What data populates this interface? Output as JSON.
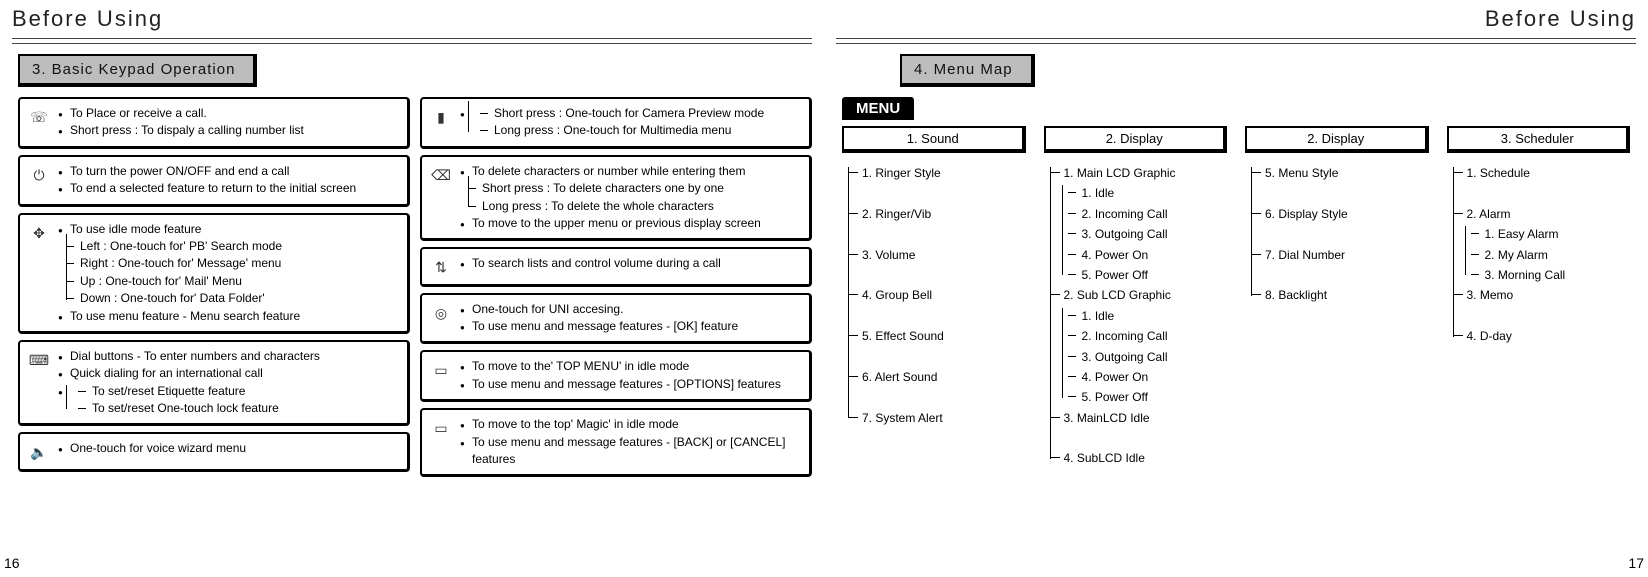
{
  "header_left": "Before Using",
  "header_right": "Before Using",
  "page_left_num": "16",
  "page_right_num": "17",
  "section_left": "3. Basic Keypad Operation",
  "section_right": "4. Menu Map",
  "menu_badge": "MENU",
  "kp": {
    "box1": {
      "l1": "To Place or receive a call.",
      "l2": "Short press : To dispaly a calling number list"
    },
    "box2": {
      "l1": "To turn the power ON/OFF and end a call",
      "l2": "To end a selected feature to return to the initial screen"
    },
    "box3": {
      "l1": "To use idle mode feature",
      "s1": "Left :  One-touch for' PB' Search mode",
      "s2": "Right : One-touch for' Message' menu",
      "s3": "Up : One-touch for' Mail' Menu",
      "s4": "Down : One-touch for' Data Folder'",
      "l2": "To use menu feature -  Menu search feature"
    },
    "box4": {
      "l1": "Dial buttons -  To enter numbers and characters",
      "l2": "Quick dialing for an international call",
      "s1": "To set/reset Etiquette feature",
      "s2": "To set/reset One-touch lock feature"
    },
    "box5": {
      "l1": "One-touch for voice wizard menu"
    },
    "box6": {
      "s1": "Short press : One-touch for Camera Preview mode",
      "s2": "Long press : One-touch for Multimedia menu"
    },
    "box7": {
      "l1": "To delete characters or number while entering them",
      "s1": "Short press : To delete characters one by one",
      "s2": "Long press : To delete the whole characters",
      "l2": "To move to the upper menu or previous display screen"
    },
    "box8": {
      "l1": "To search lists and control volume during a call"
    },
    "box9": {
      "l1": "One-touch for UNI accesing.",
      "l2": "To use menu and message features -  [OK] feature"
    },
    "box10": {
      "l1": "To move to the' TOP MENU' in idle mode",
      "l2": "To use menu and message features -  [OPTIONS] features"
    },
    "box11": {
      "l1": "To move to the top' Magic' in idle mode",
      "l2": "To use menu and message features -  [BACK] or [CANCEL] features"
    }
  },
  "menu": {
    "col1": {
      "title": "1. Sound",
      "items": [
        "1. Ringer Style",
        "2. Ringer/Vib",
        "3. Volume",
        "4. Group Bell",
        "5. Effect Sound",
        "6. Alert Sound",
        "7. System Alert"
      ]
    },
    "col2": {
      "title": "2. Display",
      "i1": "1. Main LCD Graphic",
      "i1s": [
        "1. Idle",
        "2. Incoming Call",
        "3. Outgoing Call",
        "4. Power On",
        "5. Power Off"
      ],
      "i2": "2. Sub LCD Graphic",
      "i2s": [
        "1. Idle",
        "2. Incoming Call",
        "3. Outgoing Call",
        "4. Power On",
        "5. Power Off"
      ],
      "i3": "3. MainLCD Idle",
      "i4": "4. SubLCD Idle"
    },
    "col3": {
      "title": "2. Display",
      "items": [
        "5. Menu Style",
        "6. Display Style",
        "7. Dial Number",
        "8. Backlight"
      ]
    },
    "col4": {
      "title": "3. Scheduler",
      "i1": "1. Schedule",
      "i2": "2. Alarm",
      "i2s": [
        "1. Easy Alarm",
        "2. My Alarm",
        "3. Morning Call"
      ],
      "i3": "3. Memo",
      "i4": "4. D-day"
    }
  }
}
